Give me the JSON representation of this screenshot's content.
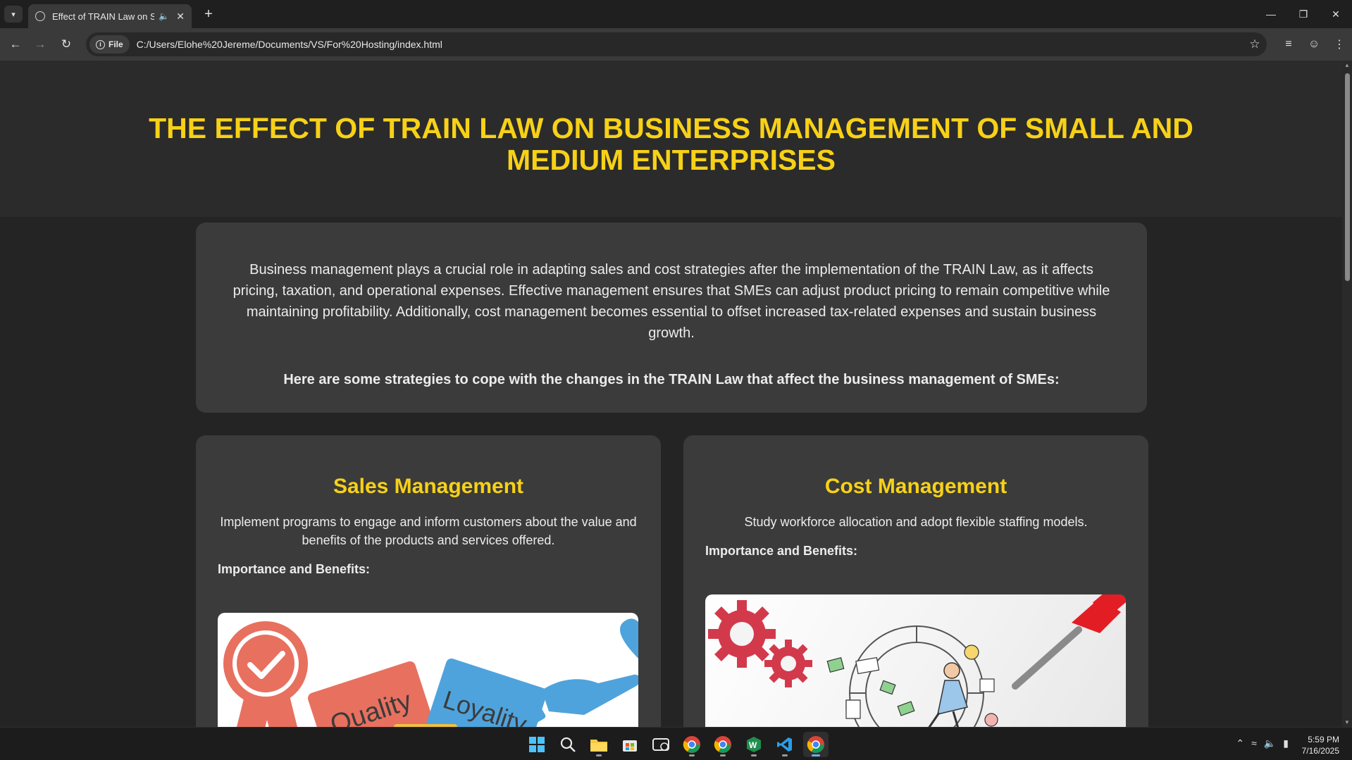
{
  "browser": {
    "tab_title": "Effect of TRAIN Law on SMEs",
    "chip_label": "File",
    "url": "C:/Users/Elohe%20Jereme/Documents/VS/For%20Hosting/index.html"
  },
  "page": {
    "title": "THE EFFECT OF TRAIN LAW ON BUSINESS MANAGEMENT OF SMALL AND MEDIUM ENTERPRISES",
    "intro_paragraph": "Business management plays a crucial role in adapting sales and cost strategies after the implementation of the TRAIN Law, as it affects pricing, taxation, and operational expenses. Effective management ensures that SMEs can adjust product pricing to remain competitive while maintaining profitability. Additionally, cost management becomes essential to offset increased tax-related expenses and sustain business growth.",
    "strategies_heading": "Here are some strategies to cope with the changes in the TRAIN Law that affect the business management of SMEs:",
    "cards": [
      {
        "heading": "Sales Management",
        "description": "Implement programs to engage and inform customers about the value and benefits of the products and services offered.",
        "benefits_label": "Importance and Benefits:",
        "image_words": [
          "Quality",
          "Loyality"
        ]
      },
      {
        "heading": "Cost Management",
        "description": "Study workforce allocation and adopt flexible staffing models.",
        "benefits_label": "Importance and Benefits:"
      }
    ]
  },
  "taskbar": {
    "apps": [
      "windows-start-icon",
      "search-icon",
      "file-explorer-icon",
      "microsoft-store-icon",
      "remote-desktop-icon",
      "chrome-profile-1-icon",
      "chrome-profile-2-icon",
      "app-w-icon",
      "vscode-icon",
      "chrome-icon"
    ],
    "time": "5:59 PM",
    "date": "7/16/2025"
  },
  "colors": {
    "accent_yellow": "#f7d117",
    "page_bg": "#242424",
    "card_bg": "#3b3b3b"
  }
}
